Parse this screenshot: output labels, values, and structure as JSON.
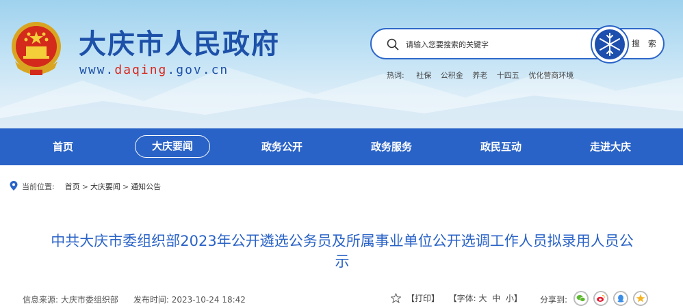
{
  "header": {
    "site_title": "大庆市人民政府",
    "url_prefix": "www.",
    "url_highlight": "daqing",
    "url_suffix": ".gov.cn"
  },
  "search": {
    "placeholder": "请输入您要搜索的关键字",
    "button_label": "搜 索"
  },
  "hotwords": {
    "label": "热词:",
    "items": [
      "社保",
      "公积金",
      "养老",
      "十四五",
      "优化营商环境"
    ]
  },
  "nav": {
    "items": [
      "首页",
      "大庆要闻",
      "政务公开",
      "政务服务",
      "政民互动",
      "走进大庆"
    ],
    "active_index": 1
  },
  "breadcrumb": {
    "label": "当前位置:",
    "items": [
      "首页",
      "大庆要闻",
      "通知公告"
    ],
    "separator": ">"
  },
  "article": {
    "title_line1": "中共大庆市委组织部2023年公开遴选公务员及所属事业单位公开选调工作人员拟录用人员公",
    "title_line2": "示",
    "source_label": "信息来源:",
    "source_value": "大庆市委组织部",
    "date_label": "发布时间:",
    "date_value": "2023-10-24 18:42"
  },
  "tools": {
    "print_label": "【打印】",
    "font_label": "【字体:",
    "font_large": "大",
    "font_medium": "中",
    "font_small": "小",
    "font_close": "】",
    "share_label": "分享到:",
    "share_icons": [
      "wechat-icon",
      "weibo-icon",
      "qq-icon",
      "qzone-icon"
    ]
  },
  "colors": {
    "brand_blue": "#2a63c7",
    "title_blue": "#1d50a8",
    "url_red": "#d9261c"
  }
}
